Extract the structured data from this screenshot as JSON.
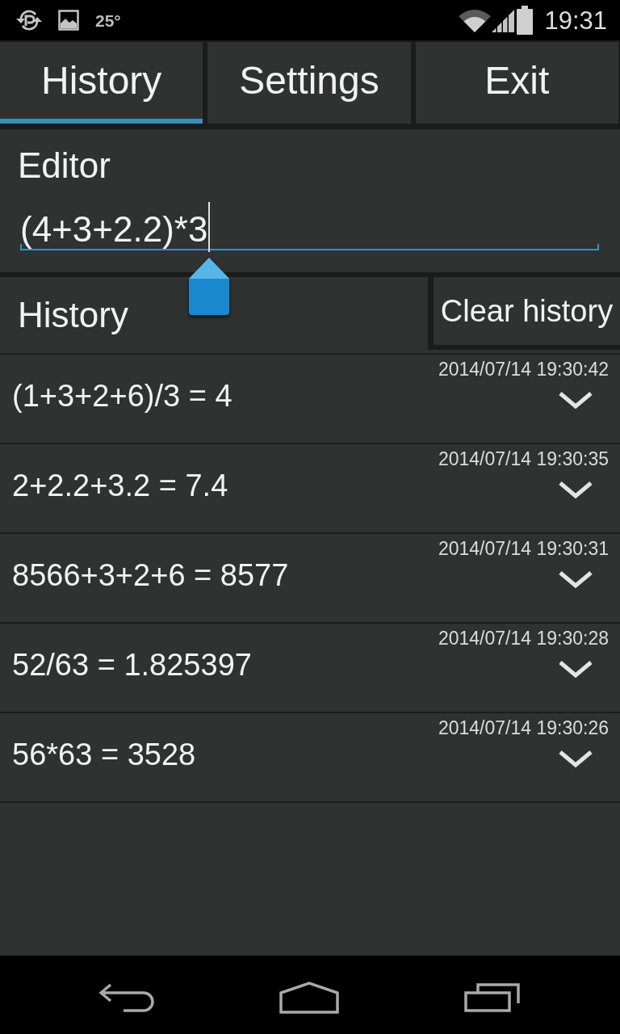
{
  "status_bar": {
    "temperature": "25°",
    "time": "19:31"
  },
  "tabs": [
    {
      "label": "History",
      "selected": true
    },
    {
      "label": "Settings",
      "selected": false
    },
    {
      "label": "Exit",
      "selected": false
    }
  ],
  "editor": {
    "title": "Editor",
    "value": "(4+3+2.2)*3"
  },
  "history": {
    "title": "History",
    "clear_button": "Clear history",
    "entries": [
      {
        "timestamp": "2014/07/14 19:30:42",
        "expression": "(1+3+2+6)/3 = 4"
      },
      {
        "timestamp": "2014/07/14 19:30:35",
        "expression": "2+2.2+3.2 = 7.4"
      },
      {
        "timestamp": "2014/07/14 19:30:31",
        "expression": "8566+3+2+6 = 8577"
      },
      {
        "timestamp": "2014/07/14 19:30:28",
        "expression": "52/63 = 1.825397"
      },
      {
        "timestamp": "2014/07/14 19:30:26",
        "expression": "56*63 = 3528"
      }
    ]
  }
}
